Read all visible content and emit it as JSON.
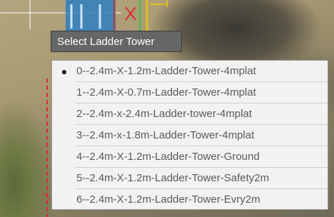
{
  "popup": {
    "title": "Select Ladder Tower"
  },
  "menu": {
    "selected_index": 0,
    "items": [
      {
        "label": "0--2.4m-X-1.2m-Ladder-Tower-4mplat",
        "selected": true
      },
      {
        "label": "1--2.4m-X-0.7m-Ladder-Tower-4mplat",
        "selected": false
      },
      {
        "label": "2--2.4m-x-2.4m-Ladder-tower-4mplat",
        "selected": false
      },
      {
        "label": "3--2.4m-x-1.8m-Ladder-Tower-4mplat",
        "selected": false
      },
      {
        "label": "4--2.4m-X-1.2m-Ladder-Tower-Ground",
        "selected": false
      },
      {
        "label": "5--2.4m-X-1.2m-Ladder-Tower-Safety2m",
        "selected": false
      },
      {
        "label": "6--2.4m-X-1.2m-Ladder-Tower-Evry2m",
        "selected": false
      }
    ]
  },
  "colors": {
    "title_bg": "#666666",
    "menu_bg": "#f2f2f2",
    "item_text": "#5a5a5a"
  },
  "icons": {
    "selected_marker": "bullet-icon"
  }
}
